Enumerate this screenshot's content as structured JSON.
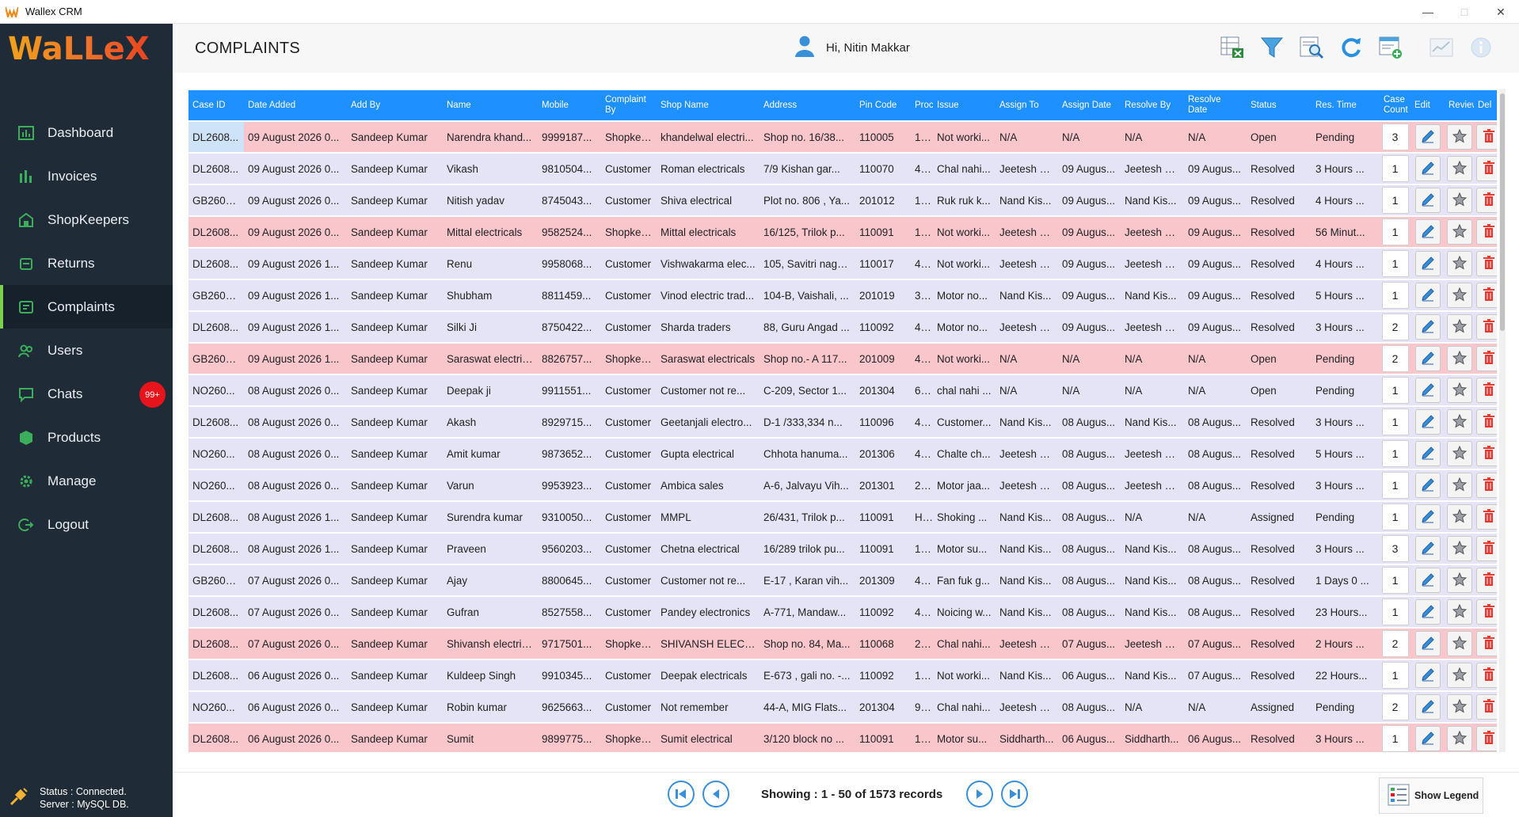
{
  "window": {
    "title": "Wallex CRM"
  },
  "brand": {
    "logo_text": "WaLLeX"
  },
  "sidebar": {
    "items": [
      {
        "label": "Dashboard",
        "icon": "dashboard-icon"
      },
      {
        "label": "Invoices",
        "icon": "invoices-icon"
      },
      {
        "label": "ShopKeepers",
        "icon": "shopkeepers-icon"
      },
      {
        "label": "Returns",
        "icon": "returns-icon"
      },
      {
        "label": "Complaints",
        "icon": "complaints-icon",
        "active": true
      },
      {
        "label": "Users",
        "icon": "users-icon"
      },
      {
        "label": "Chats",
        "icon": "chats-icon",
        "badge": "99+"
      },
      {
        "label": "Products",
        "icon": "products-icon"
      },
      {
        "label": "Manage",
        "icon": "manage-icon"
      },
      {
        "label": "Logout",
        "icon": "logout-icon"
      }
    ],
    "status_line1": "Status :  Connected.",
    "status_line2": "Server :  MySQL DB."
  },
  "header": {
    "title": "COMPLAINTS",
    "greeting": "Hi, Nitin Makkar"
  },
  "table": {
    "columns": [
      "Case ID",
      "Date Added",
      "Add By",
      "Name",
      "Mobile",
      "Complaint By",
      "Shop Name",
      "Address",
      "Pin Code",
      "Proc",
      "Issue",
      "Assign To",
      "Assign Date",
      "Resolve By",
      "Resolve Date",
      "Status",
      "Res. Time",
      "Case Count",
      "Edit",
      "Review",
      "Del"
    ],
    "rows": [
      [
        "DL2608...",
        "09 August 2026 0...",
        "Sandeep Kumar",
        "Narendra khand...",
        "9999187...",
        "Shopkee...",
        "khandelwal electri...",
        "Shop no. 16/38...",
        "110005",
        "1...",
        "Not worki...",
        "N/A",
        "N/A",
        "N/A",
        "N/A",
        "Open",
        "Pending",
        "3"
      ],
      [
        "DL2608...",
        "09 August 2026 0...",
        "Sandeep Kumar",
        "Vikash",
        "9810504...",
        "Customer",
        "Roman electricals",
        "7/9   Kishan gar...",
        "110070",
        "4...",
        "Chal nahi...",
        "Jeetesh K...",
        "09 Augus...",
        "Jeetesh K...",
        "09 Augus...",
        "Resolved",
        "3 Hours ...",
        "1"
      ],
      [
        "GB2608...",
        "09 August 2026 0...",
        "Sandeep Kumar",
        "Nitish yadav",
        "8745043...",
        "Customer",
        "Shiva electrical",
        "Plot no. 806 , Ya...",
        "201012",
        "1...",
        "Ruk ruk k...",
        "Nand Kis...",
        "09 Augus...",
        "Nand Kis...",
        "09 Augus...",
        "Resolved",
        "4 Hours ...",
        "1"
      ],
      [
        "DL2608...",
        "09 August 2026 0...",
        "Sandeep Kumar",
        "Mittal electricals",
        "9582524...",
        "Shopkee...",
        "Mittal electricals",
        "16/125, Trilok p...",
        "110091",
        "1...",
        "Not worki...",
        "Jeetesh K...",
        "09 Augus...",
        "Jeetesh K...",
        "09 Augus...",
        "Resolved",
        "56 Minut...",
        "1"
      ],
      [
        "DL2608...",
        "09 August 2026 1...",
        "Sandeep Kumar",
        "Renu",
        "9958068...",
        "Customer",
        "Vishwakarma elec...",
        "105, Savitri naga...",
        "110017",
        "4...",
        "Not worki...",
        "Jeetesh K...",
        "09 Augus...",
        "Jeetesh K...",
        "09 Augus...",
        "Resolved",
        "4 Hours ...",
        "1"
      ],
      [
        "GB2608...",
        "09 August 2026 1...",
        "Sandeep Kumar",
        "Shubham",
        "8811459...",
        "Customer",
        "Vinod electric trad...",
        "104-B, Vaishali, ...",
        "201019",
        "3...",
        "Motor no...",
        "Nand Kis...",
        "09 Augus...",
        "Nand Kis...",
        "09 Augus...",
        "Resolved",
        "5 Hours ...",
        "1"
      ],
      [
        "DL2608...",
        "09 August 2026 1...",
        "Sandeep Kumar",
        "Silki Ji",
        "8750422...",
        "Customer",
        "Sharda traders",
        "88, Guru Angad ...",
        "110092",
        "4...",
        "Motor no...",
        "Jeetesh K...",
        "09 Augus...",
        "Jeetesh K...",
        "09 Augus...",
        "Resolved",
        "3 Hours ...",
        "2"
      ],
      [
        "GB2608...",
        "09 August 2026 1...",
        "Sandeep Kumar",
        "Saraswat electric...",
        "8826757...",
        "Shopkee...",
        "Saraswat electricals",
        "Shop no.- A 117...",
        "201009",
        "4...",
        "Not worki...",
        "N/A",
        "N/A",
        "N/A",
        "N/A",
        "Open",
        "Pending",
        "2"
      ],
      [
        "NO260...",
        "08 August 2026 0...",
        "Sandeep Kumar",
        "Deepak ji",
        "9911551...",
        "Customer",
        "Customer not re...",
        "C-209, Sector 1...",
        "201304",
        "6...",
        "chal nahi ...",
        "N/A",
        "N/A",
        "N/A",
        "N/A",
        "Open",
        "Pending",
        "1"
      ],
      [
        "DL2608...",
        "08 August 2026 0...",
        "Sandeep Kumar",
        "Akash",
        "8929715...",
        "Customer",
        "Geetanjali electro...",
        "D-1 /333,334 n...",
        "110096",
        "4...",
        "Customer...",
        "Nand Kis...",
        "08 Augus...",
        "Nand Kis...",
        "08 Augus...",
        "Resolved",
        "3 Hours ...",
        "1"
      ],
      [
        "NO260...",
        "08 August 2026 0...",
        "Sandeep Kumar",
        "Amit kumar",
        "9873652...",
        "Customer",
        "Gupta electrical",
        "Chhota hanuma...",
        "201306",
        "4...",
        "Chalte ch...",
        "Jeetesh K...",
        "08 Augus...",
        "Jeetesh K...",
        "08 Augus...",
        "Resolved",
        "5 Hours ...",
        "1"
      ],
      [
        "NO260...",
        "08 August 2026 0...",
        "Sandeep Kumar",
        "Varun",
        "9953923...",
        "Customer",
        "Ambica sales",
        "A-6,  Jalvayu Vih...",
        "201301",
        "2...",
        "Motor jaa...",
        "Jeetesh K...",
        "08 Augus...",
        "Jeetesh K...",
        "08 Augus...",
        "Resolved",
        "3 Hours ...",
        "1"
      ],
      [
        "DL2608...",
        "08 August 2026 1...",
        "Sandeep Kumar",
        "Surendra kumar",
        "9310050...",
        "Customer",
        "MMPL",
        "26/431, Trilok p...",
        "110091",
        "H...",
        "Shoking ...",
        "Nand Kis...",
        "08 Augus...",
        "N/A",
        "N/A",
        "Assigned",
        "Pending",
        "1"
      ],
      [
        "DL2608...",
        "08 August 2026 1...",
        "Sandeep Kumar",
        "Praveen",
        "9560203...",
        "Customer",
        "Chetna electrical",
        "16/289 trilok pu...",
        "110091",
        "1...",
        "Motor su...",
        "Nand Kis...",
        "08 Augus...",
        "Nand Kis...",
        "08 Augus...",
        "Resolved",
        "3 Hours ...",
        "3"
      ],
      [
        "GB2608...",
        "07 August 2026 0...",
        "Sandeep Kumar",
        "Ajay",
        "8800645...",
        "Customer",
        "Customer not re...",
        "E-17 , Karan vih...",
        "201309",
        "4...",
        "Fan fuk g...",
        "Nand Kis...",
        "08 Augus...",
        "Nand Kis...",
        "08 Augus...",
        "Resolved",
        "1 Days 0 ...",
        "1"
      ],
      [
        "DL2608...",
        "07 August 2026 0...",
        "Sandeep Kumar",
        "Gufran",
        "8527558...",
        "Customer",
        "Pandey electronics",
        "A-771, Mandaw...",
        "110092",
        "4...",
        "Noicing w...",
        "Nand Kis...",
        "08 Augus...",
        "Nand Kis...",
        "08 Augus...",
        "Resolved",
        "23 Hours...",
        "1"
      ],
      [
        "DL2608...",
        "07 August 2026 0...",
        "Sandeep Kumar",
        "Shivansh electric...",
        "9717501...",
        "Shopkee...",
        "SHIVANSH ELECT...",
        "Shop no. 84, Ma...",
        "110068",
        "2...",
        "Chal nahi...",
        "Jeetesh K...",
        "07 Augus...",
        "Jeetesh K...",
        "07 Augus...",
        "Resolved",
        "2 Hours ...",
        "2"
      ],
      [
        "DL2608...",
        "06 August 2026 0...",
        "Sandeep Kumar",
        "Kuldeep Singh",
        "9910345...",
        "Customer",
        "Deepak electricals",
        "E-673 , gali no. -...",
        "110092",
        "1...",
        "Not worki...",
        "Nand Kis...",
        "06 Augus...",
        "Nand Kis...",
        "07 Augus...",
        "Resolved",
        "22 Hours...",
        "1"
      ],
      [
        "NO260...",
        "06 August 2026 0...",
        "Sandeep Kumar",
        "Robin kumar",
        "9625663...",
        "Customer",
        "Not remember",
        "44-A,  MIG Flats...",
        "201304",
        "9...",
        "Chal nahi...",
        "Jeetesh K...",
        "08 Augus...",
        "N/A",
        "N/A",
        "Assigned",
        "Pending",
        "2"
      ],
      [
        "DL2608...",
        "06 August 2026 0...",
        "Sandeep Kumar",
        "Sumit",
        "9899775...",
        "Shopkee...",
        "Sumit electrical",
        "3/120 block no ...",
        "110091",
        "1...",
        "Motor su...",
        "Siddharth...",
        "06 Augus...",
        "Siddharth...",
        "06 Augus...",
        "Resolved",
        "3 Hours ...",
        "1"
      ]
    ]
  },
  "footer": {
    "showing": "Showing : 1 - 50 of 1573 records",
    "legend_label": "Show Legend"
  },
  "colors": {
    "header_blue": "#1e90ff",
    "open_row": "#f9c7cb",
    "other_row": "#e4e4f6",
    "sidebar": "#1f2b37",
    "accent_green": "#7bd14a"
  }
}
